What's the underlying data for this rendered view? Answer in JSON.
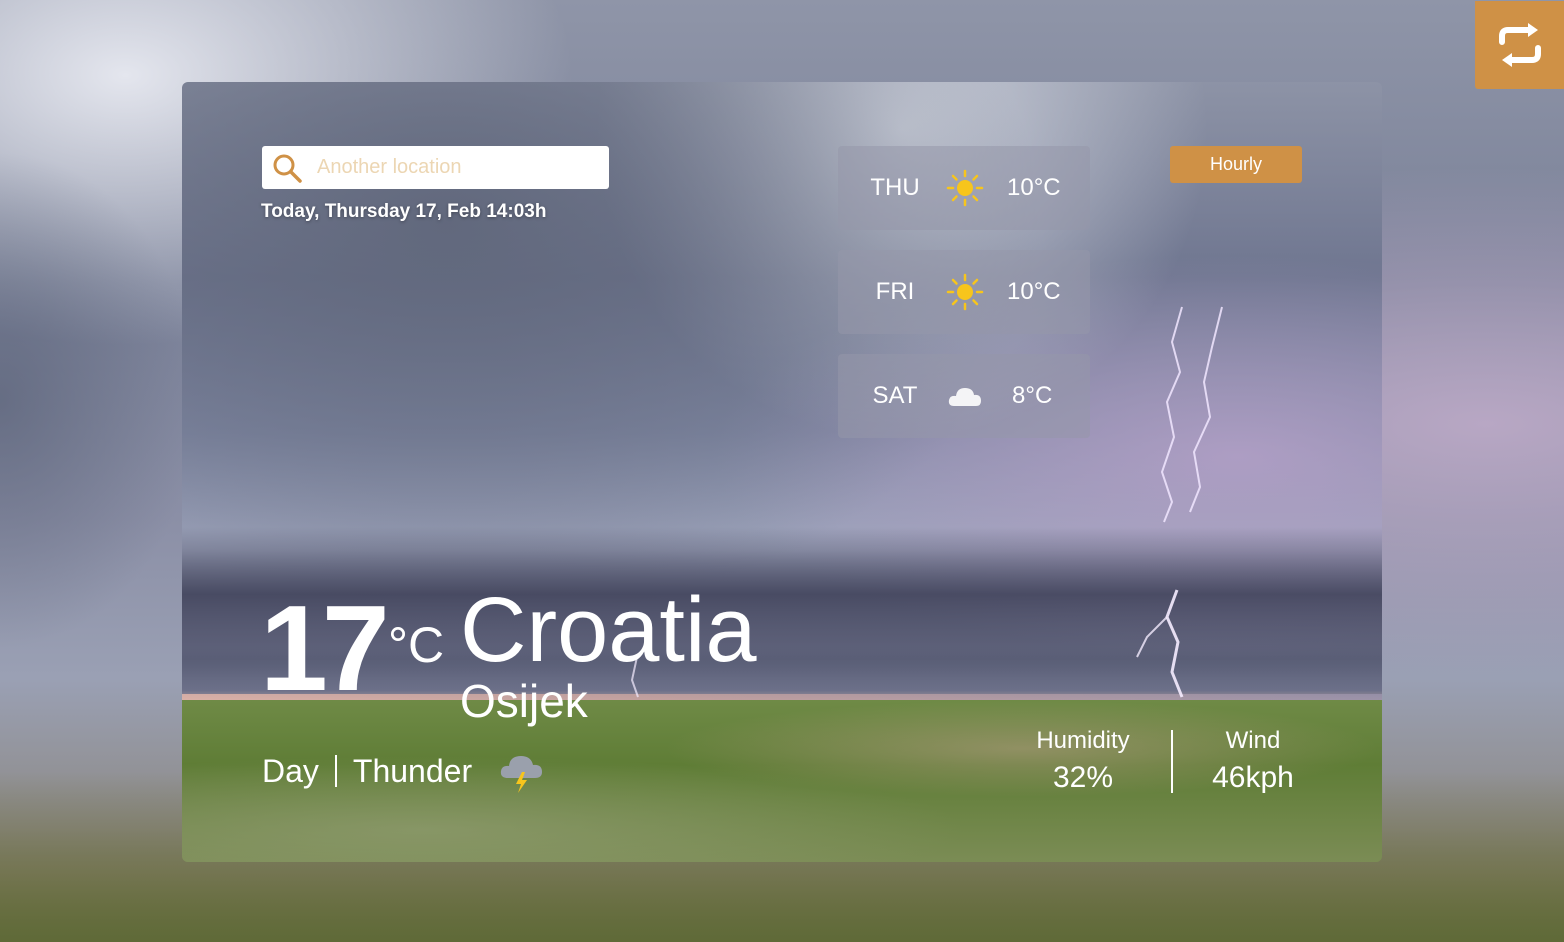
{
  "search": {
    "placeholder": "Another location"
  },
  "datetime": "Today, Thursday 17, Feb 14:03h",
  "forecast": [
    {
      "day": "THU",
      "icon": "sun-icon",
      "temp": "10°C"
    },
    {
      "day": "FRI",
      "icon": "sun-icon",
      "temp": "10°C"
    },
    {
      "day": "SAT",
      "icon": "cloud-icon",
      "temp": "8°C"
    }
  ],
  "hourly_label": "Hourly",
  "current": {
    "temp": "17",
    "unit": "°C",
    "country": "Croatia",
    "city": "Osijek",
    "period": "Day",
    "condition": "Thunder",
    "condition_icon": "thunderstorm-icon"
  },
  "stats": {
    "humidity_label": "Humidity",
    "humidity_value": "32%",
    "wind_label": "Wind",
    "wind_value": "46kph"
  },
  "colors": {
    "accent": "#cf9146",
    "sun": "#f7c51c",
    "placeholder": "#ecd6b3"
  }
}
